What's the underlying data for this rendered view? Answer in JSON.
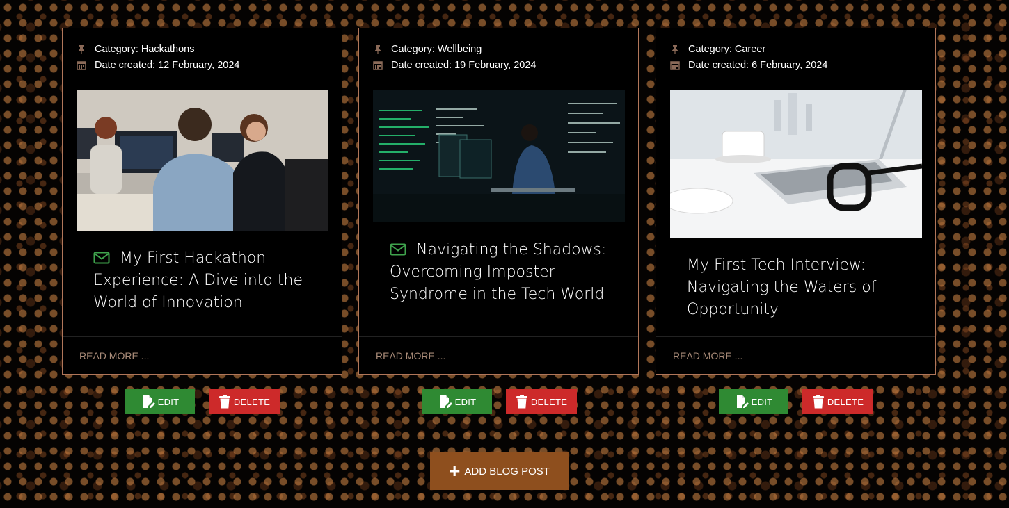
{
  "posts": [
    {
      "category": "Category: Hackathons",
      "date": "Date created: 12 February, 2024",
      "title": "My First Hackathon Experience: A Dive into the World of Innovation",
      "read_more": "READ MORE ...",
      "edit": "EDIT",
      "delete": "DELETE",
      "image": "people-coding-office-photo",
      "has_envelope_icon": true
    },
    {
      "category": "Category: Wellbeing",
      "date": "Date created: 19 February, 2024",
      "title": "Navigating the Shadows: Overcoming Imposter Syndrome in the Tech World",
      "read_more": "READ MORE ...",
      "edit": "EDIT",
      "delete": "DELETE",
      "image": "woman-at-code-screens-photo",
      "has_envelope_icon": true
    },
    {
      "category": "Category: Career",
      "date": "Date created: 6 February, 2024",
      "title": "My First Tech Interview: Navigating the Waters of Opportunity",
      "read_more": "READ MORE ...",
      "edit": "EDIT",
      "delete": "DELETE",
      "image": "laptop-coffee-glasses-photo",
      "has_envelope_icon": false
    }
  ],
  "add_button": "ADD BLOG POST",
  "colors": {
    "edit": "#2f8a33",
    "delete": "#cd2a2a",
    "add": "#8e4f1e",
    "card_border": "#b0765a",
    "icon_green": "#3fa34d"
  }
}
